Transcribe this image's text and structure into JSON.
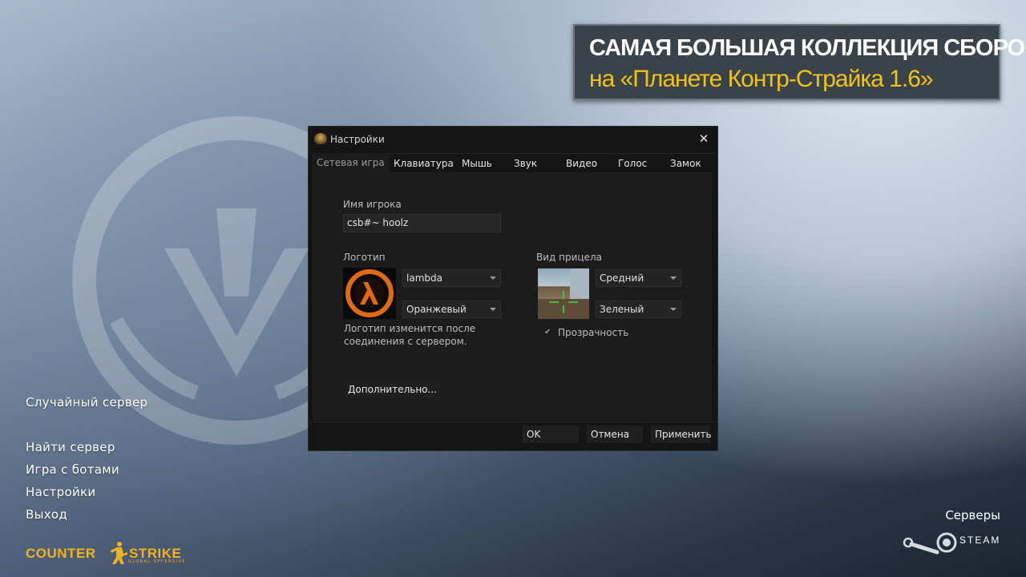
{
  "banner": {
    "line1": "САМАЯ БОЛЬШАЯ КОЛЛЕКЦИЯ СБОРОК",
    "line2": "на «Планете Контр-Страйка 1.6»",
    "accent_color": "#f2c21a"
  },
  "dialog": {
    "title": "Настройки",
    "close_icon": "✕",
    "tabs": [
      {
        "label": "Сетевая игра",
        "active": true
      },
      {
        "label": "Клавиатура"
      },
      {
        "label": "Мышь"
      },
      {
        "label": "Звук"
      },
      {
        "label": "Видео"
      },
      {
        "label": "Голос"
      },
      {
        "label": "Замок"
      }
    ],
    "player_name_label": "Имя игрока",
    "player_name_value": "csb#~ hoolz",
    "logo_label": "Логотип",
    "logo_combo": "lambda",
    "logo_color_combo": "Оранжевый",
    "logo_note": [
      "Логотип изменится после",
      "соединения с сервером."
    ],
    "crosshair_label": "Вид прицела",
    "crosshair_size_combo": "Средний",
    "crosshair_color_combo": "Зеленый",
    "transparency_label": "Прозрачность",
    "transparency_checked": true,
    "advanced_button": "Дополнительно...",
    "ok_button": "OK",
    "cancel_button": "Отмена",
    "apply_button": "Применить"
  },
  "menu": {
    "items": [
      "Случайный сервер",
      "Найти сервер",
      "Игра с ботами",
      "Настройки",
      "Выход"
    ]
  },
  "footer": {
    "logo_text_left": "COUNTER",
    "logo_text_right": "STRIKE",
    "logo_subtitle": "GLOBAL OFFENSIVE",
    "logo_color": "#f0b21e",
    "servers_link": "Серверы",
    "steam_label": "STEAM"
  }
}
